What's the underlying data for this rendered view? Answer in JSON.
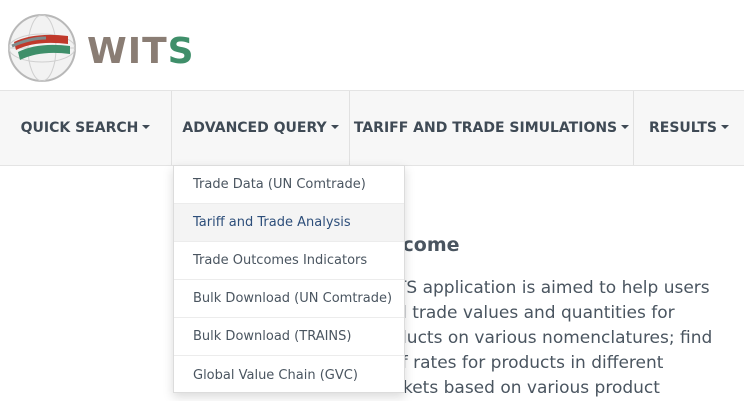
{
  "brand": {
    "name_main": "WIT",
    "name_end": "S",
    "logo_icon": "globe-logo-icon",
    "colors": {
      "text": "#8a7d74",
      "accent": "#3f8f6a",
      "red": "#c0392b"
    }
  },
  "nav": {
    "items": [
      {
        "label": "QUICK SEARCH",
        "caret": "▾"
      },
      {
        "label": "ADVANCED QUERY",
        "caret": "▾"
      },
      {
        "label": "TARIFF AND TRADE SIMULATIONS",
        "caret": "▾"
      },
      {
        "label": "RESULTS",
        "caret": "▾"
      }
    ]
  },
  "dropdown": {
    "items": [
      {
        "label": "Trade Data (UN Comtrade)"
      },
      {
        "label": "Tariff and Trade Analysis"
      },
      {
        "label": "Trade Outcomes Indicators"
      },
      {
        "label": "Bulk Download (UN Comtrade)"
      },
      {
        "label": "Bulk Download (TRAINS)"
      },
      {
        "label": "Global Value Chain (GVC)"
      }
    ]
  },
  "welcome": {
    "title": "lcome",
    "lines": [
      "TS application is aimed to help users",
      "d trade values and quantities for",
      "ducts on various nomenclatures; find",
      "ff rates for products in different",
      "rkets based on various product"
    ]
  }
}
